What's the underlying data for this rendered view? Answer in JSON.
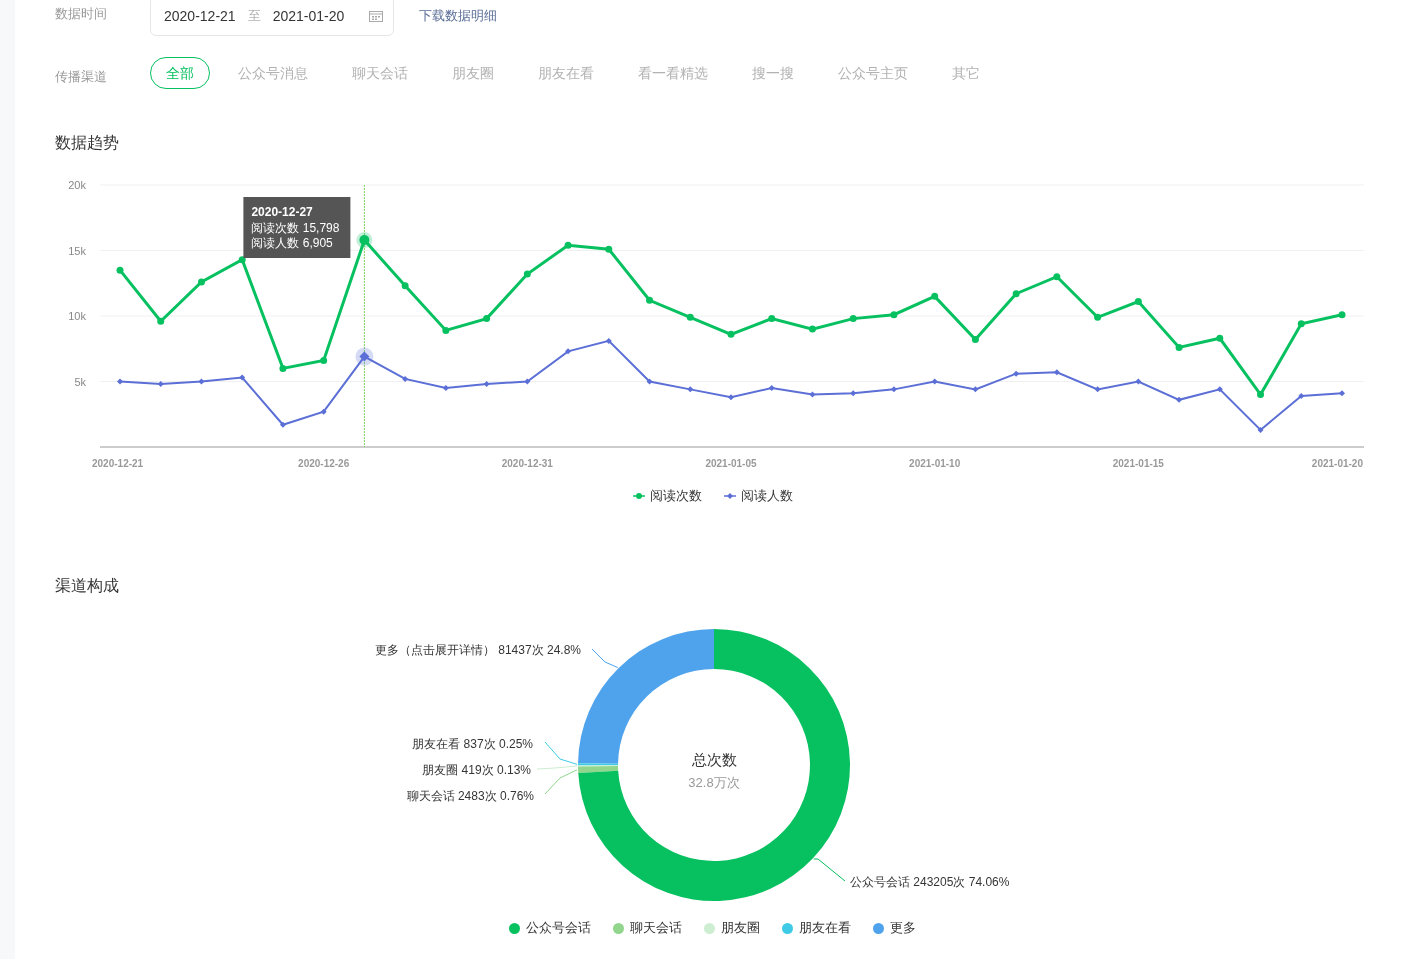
{
  "filters": {
    "date_label": "数据时间",
    "start_date": "2020-12-21",
    "date_separator": "至",
    "end_date": "2021-01-20",
    "download_link": "下载数据明细",
    "channel_label": "传播渠道",
    "channels": [
      {
        "label": "全部",
        "selected": true
      },
      {
        "label": "公众号消息",
        "selected": false
      },
      {
        "label": "聊天会话",
        "selected": false
      },
      {
        "label": "朋友圈",
        "selected": false
      },
      {
        "label": "朋友在看",
        "selected": false
      },
      {
        "label": "看一看精选",
        "selected": false
      },
      {
        "label": "搜一搜",
        "selected": false
      },
      {
        "label": "公众号主页",
        "selected": false
      },
      {
        "label": "其它",
        "selected": false
      }
    ]
  },
  "trend": {
    "title": "数据趋势",
    "chart_data": {
      "type": "line",
      "categories": [
        "2020-12-21",
        null,
        null,
        null,
        null,
        "2020-12-26",
        null,
        null,
        null,
        null,
        "2020-12-31",
        null,
        null,
        null,
        null,
        "2021-01-05",
        null,
        null,
        null,
        null,
        "2021-01-10",
        null,
        null,
        null,
        null,
        "2021-01-15",
        null,
        null,
        null,
        null,
        "2021-01-20"
      ],
      "ylim": [
        0,
        20000
      ],
      "yticks": [
        {
          "value": 5000,
          "label": "5k"
        },
        {
          "value": 10000,
          "label": "10k"
        },
        {
          "value": 15000,
          "label": "15k"
        },
        {
          "value": 20000,
          "label": "20k"
        }
      ],
      "series": [
        {
          "name": "阅读次数",
          "color": "#07c160",
          "marker": "circle",
          "values": [
            13500,
            9600,
            12600,
            14300,
            6000,
            6600,
            15798,
            12300,
            8900,
            9800,
            13200,
            15400,
            15100,
            11200,
            9900,
            8600,
            9800,
            9000,
            9800,
            10100,
            11500,
            8200,
            11700,
            13000,
            9900,
            11100,
            7600,
            8300,
            4000,
            9400,
            10100
          ]
        },
        {
          "name": "阅读人数",
          "color": "#5b6fd6",
          "marker": "diamond",
          "values": [
            5000,
            4800,
            5000,
            5300,
            1700,
            2700,
            6905,
            5200,
            4500,
            4800,
            5000,
            7300,
            8100,
            5000,
            4400,
            3800,
            4500,
            4000,
            4100,
            4400,
            5000,
            4400,
            5600,
            5700,
            4400,
            5000,
            3600,
            4400,
            1300,
            3900,
            4100
          ]
        }
      ],
      "grid": true
    },
    "points": [
      {
        "selected": false
      },
      {
        "selected": false
      },
      {
        "selected": false
      },
      {
        "selected": false
      },
      {
        "selected": false
      },
      {
        "selected": false
      },
      {
        "selected": true
      },
      {
        "selected": false
      },
      {
        "selected": false
      },
      {
        "selected": false
      },
      {
        "selected": false
      },
      {
        "selected": false
      },
      {
        "selected": false
      },
      {
        "selected": false
      },
      {
        "selected": false
      },
      {
        "selected": false
      },
      {
        "selected": false
      },
      {
        "selected": false
      },
      {
        "selected": false
      },
      {
        "selected": false
      },
      {
        "selected": false
      },
      {
        "selected": false
      },
      {
        "selected": false
      },
      {
        "selected": false
      },
      {
        "selected": false
      },
      {
        "selected": false
      },
      {
        "selected": false
      },
      {
        "selected": false
      },
      {
        "selected": false
      },
      {
        "selected": false
      },
      {
        "selected": false
      }
    ],
    "tooltip": {
      "title": "2020-12-27",
      "lines": [
        "阅读次数 15,798",
        "阅读人数 6,905"
      ]
    }
  },
  "composition": {
    "title": "渠道构成",
    "center_title": "总次数",
    "center_value": "32.8万次",
    "chart_data": {
      "type": "donut",
      "categories": [
        "更多（点击展开详情） 81437次 24.8%",
        "朋友在看 837次 0.25%",
        "朋友圈 419次 0.13%",
        "聊天会话 2483次 0.76%",
        "公众号会话 243205次 74.06%"
      ],
      "values": [
        24.8,
        0.25,
        0.13,
        0.76,
        74.06
      ]
    },
    "slices": [
      {
        "color": "#4fa3ec"
      },
      {
        "color": "#3fcbe6"
      },
      {
        "color": "#cdeed1"
      },
      {
        "color": "#91d68c"
      },
      {
        "color": "#07c160"
      }
    ],
    "legend": [
      {
        "label": "公众号会话",
        "color": "#07c160"
      },
      {
        "label": "聊天会话",
        "color": "#91d68c"
      },
      {
        "label": "朋友圈",
        "color": "#cdeed1"
      },
      {
        "label": "朋友在看",
        "color": "#3fcbe6"
      },
      {
        "label": "更多",
        "color": "#4fa3ec"
      }
    ]
  }
}
